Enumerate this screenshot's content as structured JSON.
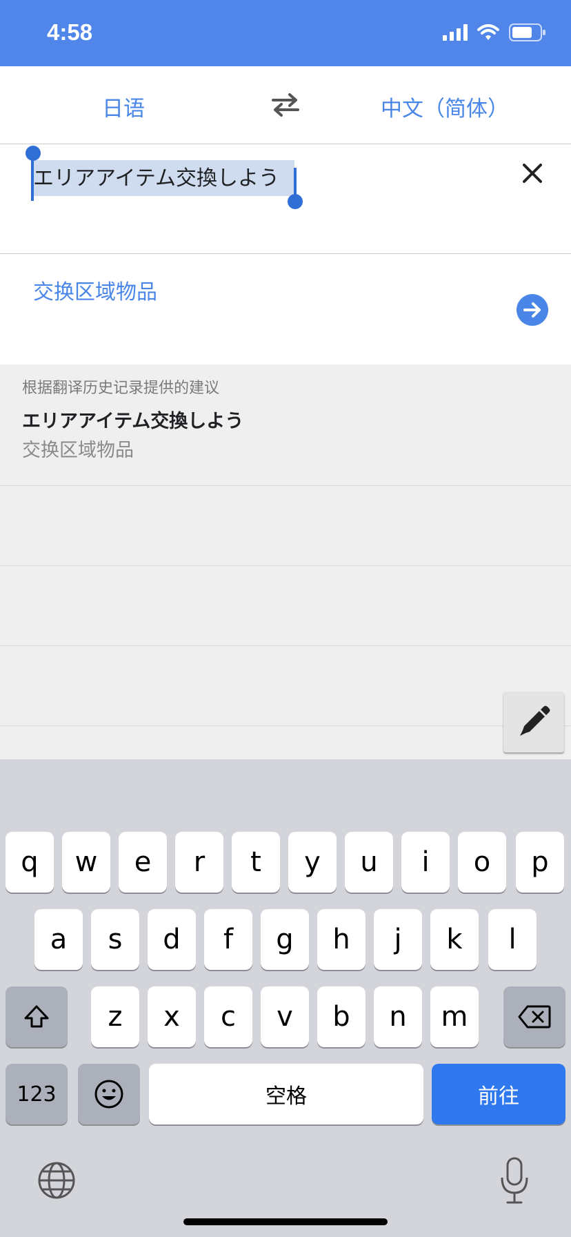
{
  "status": {
    "time": "4:58",
    "icons": [
      "signal-icon",
      "wifi-icon",
      "battery-icon"
    ]
  },
  "header": {
    "source_lang": "日语",
    "target_lang": "中文（简体）",
    "swap_icon": "swap-arrows-icon"
  },
  "input": {
    "text": "エリアアイテム交換しよう",
    "clear_icon": "close-icon"
  },
  "result": {
    "text": "交换区域物品",
    "go_icon": "arrow-right-icon"
  },
  "history": {
    "heading": "根据翻译历史记录提供的建议",
    "items": [
      {
        "source": "エリアアイテム交換しよう",
        "target": "交换区域物品"
      }
    ],
    "handwrite_icon": "pen-icon"
  },
  "keyboard": {
    "row1": [
      "q",
      "w",
      "e",
      "r",
      "t",
      "y",
      "u",
      "i",
      "o",
      "p"
    ],
    "row2": [
      "a",
      "s",
      "d",
      "f",
      "g",
      "h",
      "j",
      "k",
      "l"
    ],
    "row3": [
      "z",
      "x",
      "c",
      "v",
      "b",
      "n",
      "m"
    ],
    "numbers_label": "123",
    "space_label": "空格",
    "go_label": "前往",
    "icons": [
      "shift-icon",
      "backspace-icon",
      "emoji-icon",
      "globe-icon",
      "microphone-icon"
    ]
  },
  "colors": {
    "status_bar": "#5085ea",
    "accent": "#4a86e8",
    "go_key": "#2f78ee",
    "selection": "#cfdcef"
  }
}
